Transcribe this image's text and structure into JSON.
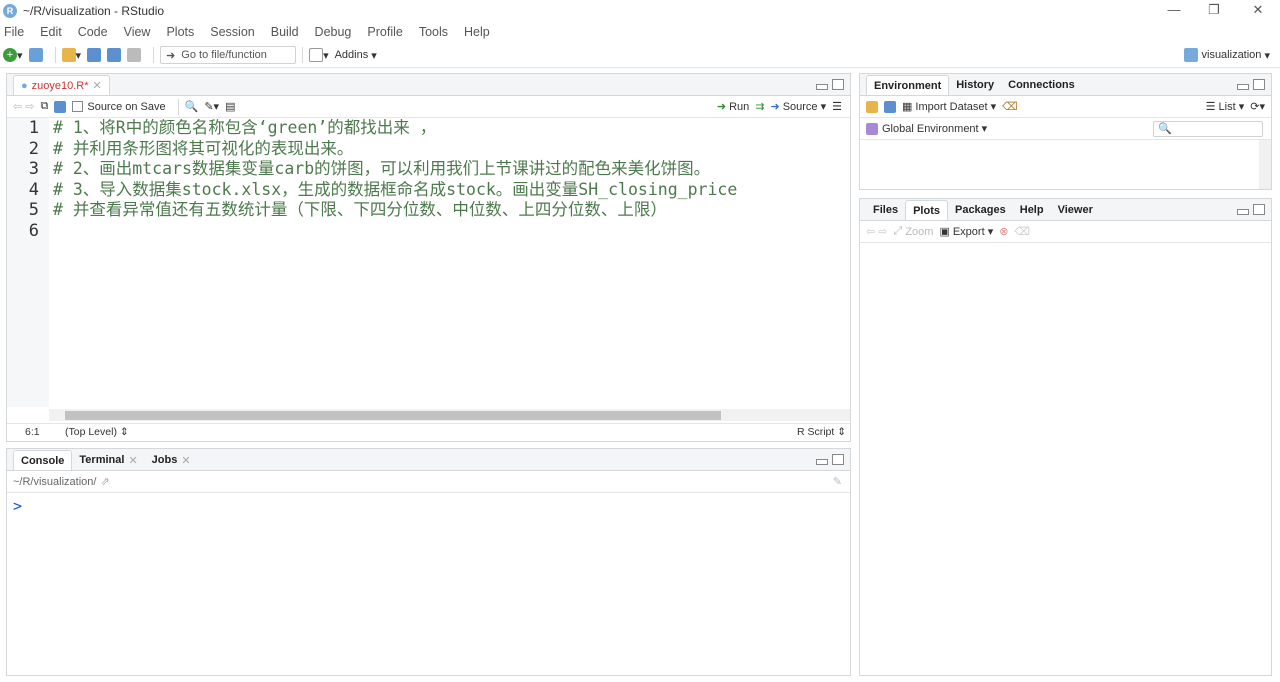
{
  "window": {
    "title": "~/R/visualization - RStudio",
    "logo": "R"
  },
  "menu": [
    "File",
    "Edit",
    "Code",
    "View",
    "Plots",
    "Session",
    "Build",
    "Debug",
    "Profile",
    "Tools",
    "Help"
  ],
  "toolbar": {
    "goto_placeholder": "Go to file/function",
    "addins": "Addins",
    "project": "visualization"
  },
  "editor": {
    "tab_label": "zuoye10.R*",
    "source_on_save": "Source on Save",
    "run": "Run",
    "source": "Source",
    "line_numbers": [
      "1",
      "2",
      "3",
      "4",
      "5",
      "6"
    ],
    "lines": [
      "# 1、将R中的颜色名称包含‘green’的都找出来 ，",
      "# 并利用条形图将其可视化的表现出来。",
      "# 2、画出mtcars数据集变量carb的饼图，可以利用我们上节课讲过的配色来美化饼图。",
      "# 3、导入数据集stock.xlsx，生成的数据框命名成stock。画出变量SH_closing_price",
      "# 并查看异常值还有五数统计量（下限、下四分位数、中位数、上四分位数、上限）",
      ""
    ],
    "status": {
      "position": "6:1",
      "scope": "(Top Level)",
      "filetype": "R Script"
    }
  },
  "console": {
    "tabs": [
      "Console",
      "Terminal",
      "Jobs"
    ],
    "path": "~/R/visualization/",
    "prompt": ">"
  },
  "env": {
    "tabs": [
      "Environment",
      "History",
      "Connections"
    ],
    "import_dataset": "Import Dataset",
    "list_label": "List",
    "scope": "Global Environment"
  },
  "files": {
    "tabs": [
      "Files",
      "Plots",
      "Packages",
      "Help",
      "Viewer"
    ],
    "zoom": "Zoom",
    "export": "Export"
  },
  "colors": {
    "accent": "#75aadb",
    "comment": "#4d7a4d",
    "prompt": "#1f4fcf"
  }
}
